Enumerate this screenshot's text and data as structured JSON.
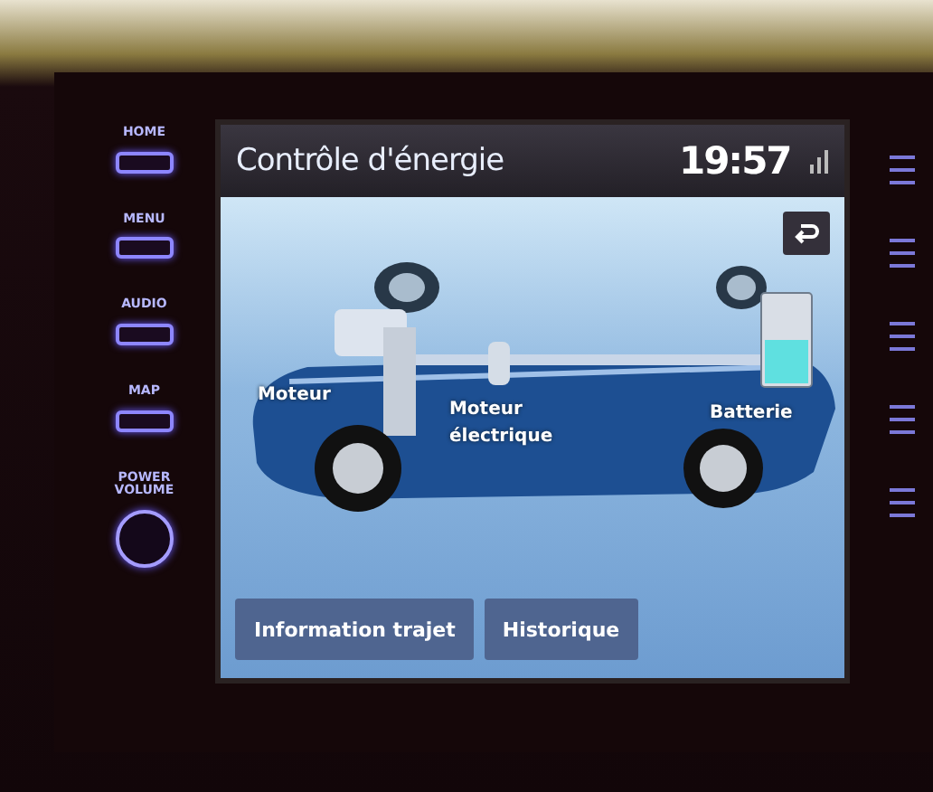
{
  "left_buttons": [
    {
      "label": "HOME",
      "kind": "key"
    },
    {
      "label": "MENU",
      "kind": "key"
    },
    {
      "label": "AUDIO",
      "kind": "key"
    },
    {
      "label": "MAP",
      "kind": "key"
    },
    {
      "label": "POWER VOLUME",
      "kind": "knob"
    }
  ],
  "screen": {
    "title": "Contrôle d'énergie",
    "time": "19:57",
    "diagram": {
      "engine_label": "Moteur",
      "motor_label": "Moteur électrique",
      "battery_label": "Batterie",
      "battery": {
        "level": 0.5
      }
    },
    "tabs": [
      {
        "label": "Information trajet"
      },
      {
        "label": "Historique"
      }
    ]
  }
}
